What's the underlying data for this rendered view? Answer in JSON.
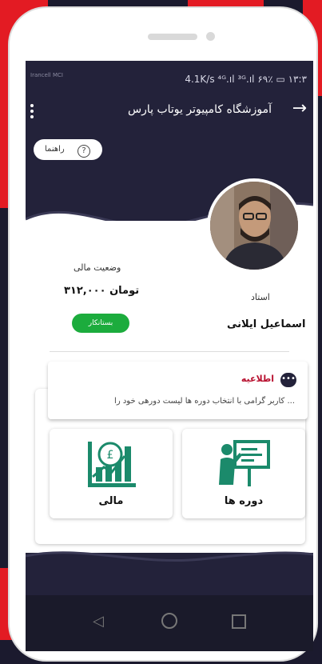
{
  "status_bar": {
    "carrier": "Irancell\nMCI",
    "right": "4.1K/s  ⁴ᴳ.ıl  ³ᴳ.ıl ۶۹٪ ▭ ۱۳:۳"
  },
  "app_bar": {
    "title": "آموزشگاه کامپیوتر یوتاب پارس"
  },
  "guide_button": {
    "label": "راهنما"
  },
  "finance": {
    "title": "وضعیت مالی",
    "amount": "۳۱۲,۰۰۰ تومان",
    "status_button": "بستانکار"
  },
  "profile": {
    "role": "استاد",
    "name": "اسماعیل ایلانی"
  },
  "notice": {
    "title": "اطلاعیه",
    "text": "کاربر گرامی با انتخاب دوره ها لیست دورهی خود را ..."
  },
  "tiles": {
    "finance_label": "مالی",
    "courses_label": "دوره ها"
  },
  "colors": {
    "dark": "#23223a",
    "accent_red": "#b8102f",
    "green": "#1cac3d",
    "teal_icon": "#1b8a6b"
  }
}
